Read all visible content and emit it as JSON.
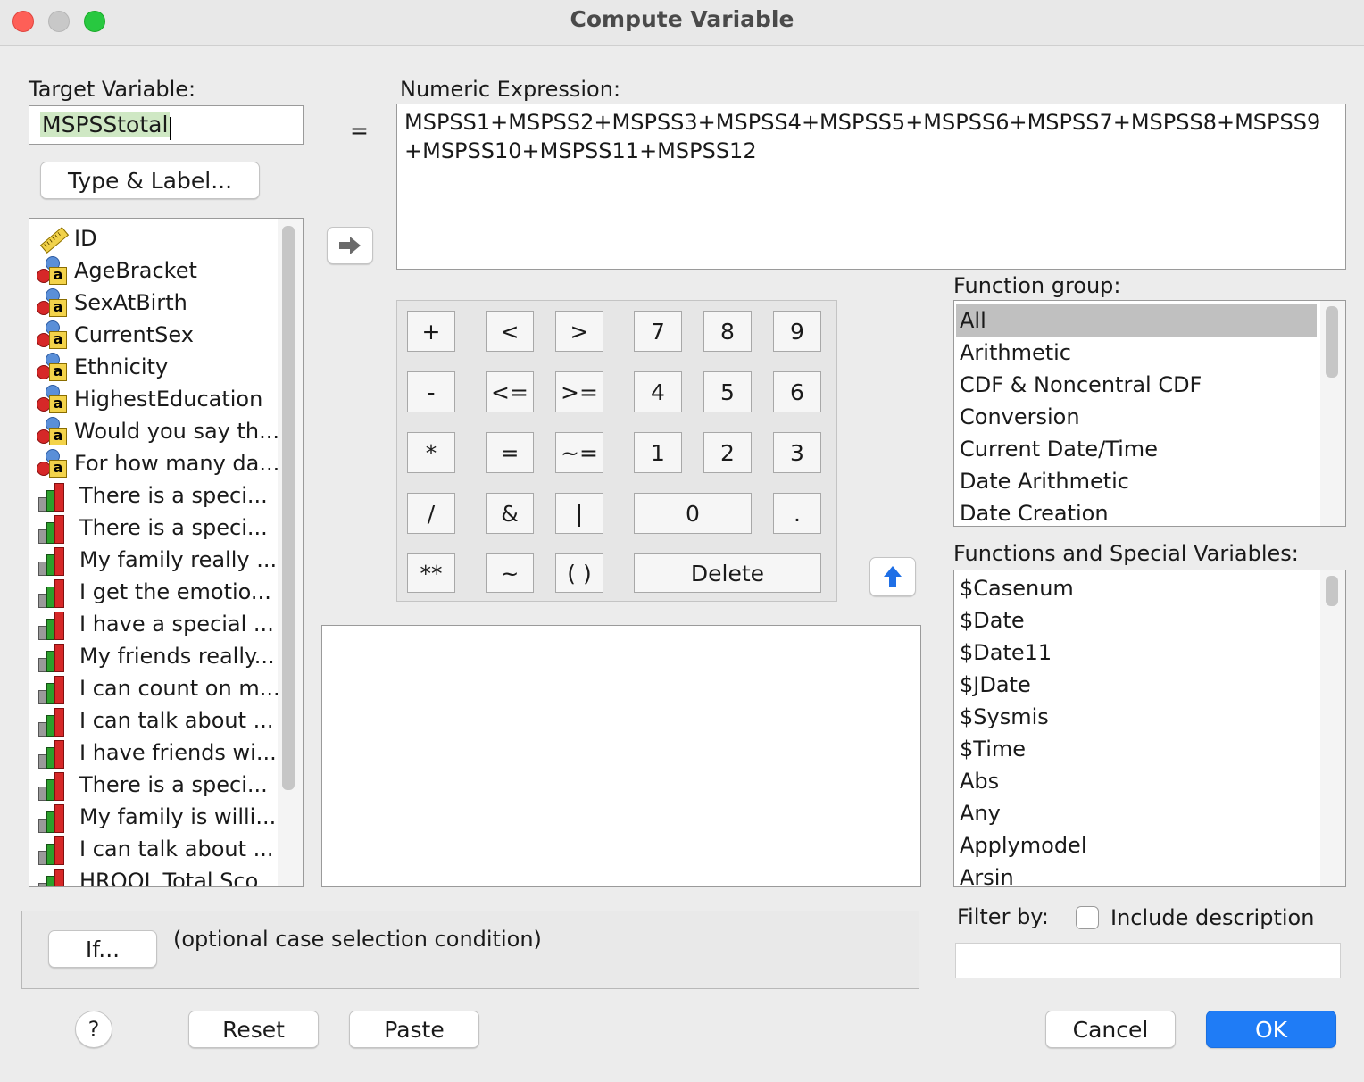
{
  "window": {
    "title": "Compute Variable"
  },
  "target": {
    "label": "Target Variable:",
    "value": "MSPSStotal",
    "type_label_button": "Type & Label..."
  },
  "equals": "=",
  "expression": {
    "label": "Numeric Expression:",
    "value": "MSPSS1+MSPSS2+MSPSS3+MSPSS4+MSPSS5+MSPSS6+MSPSS7+MSPSS8+MSPSS9+MSPSS10+MSPSS11+MSPSS12"
  },
  "variables": [
    {
      "label": "ID",
      "icon": "scale-ruler-icon"
    },
    {
      "label": "AgeBracket",
      "icon": "nominal-icon"
    },
    {
      "label": "SexAtBirth",
      "icon": "nominal-icon"
    },
    {
      "label": "CurrentSex",
      "icon": "nominal-icon"
    },
    {
      "label": "Ethnicity",
      "icon": "nominal-icon"
    },
    {
      "label": "HighestEducation",
      "icon": "nominal-icon"
    },
    {
      "label": "Would you say th...",
      "icon": "nominal-icon"
    },
    {
      "label": "For how many da...",
      "icon": "nominal-icon"
    },
    {
      "label": "There is a speci...",
      "icon": "ordinal-icon"
    },
    {
      "label": "There is a speci...",
      "icon": "ordinal-icon"
    },
    {
      "label": "My family really ...",
      "icon": "ordinal-icon"
    },
    {
      "label": "I get the emotio...",
      "icon": "ordinal-icon"
    },
    {
      "label": "I have a special ...",
      "icon": "ordinal-icon"
    },
    {
      "label": "My friends really...",
      "icon": "ordinal-icon"
    },
    {
      "label": "I can count on m...",
      "icon": "ordinal-icon"
    },
    {
      "label": "I can talk about ...",
      "icon": "ordinal-icon"
    },
    {
      "label": "I have friends wi...",
      "icon": "ordinal-icon"
    },
    {
      "label": "There is a speci...",
      "icon": "ordinal-icon"
    },
    {
      "label": "My family is willi...",
      "icon": "ordinal-icon"
    },
    {
      "label": "I can talk about ...",
      "icon": "ordinal-icon"
    },
    {
      "label": "HRQOL Total Sco...",
      "icon": "ordinal-icon"
    }
  ],
  "keypad": {
    "plus": "+",
    "lt": "<",
    "gt": ">",
    "k7": "7",
    "k8": "8",
    "k9": "9",
    "minus": "-",
    "le": "<=",
    "ge": ">=",
    "k4": "4",
    "k5": "5",
    "k6": "6",
    "mul": "*",
    "eq": "=",
    "ne": "~=",
    "k1": "1",
    "k2": "2",
    "k3": "3",
    "div": "/",
    "and": "&",
    "or": "|",
    "k0": "0",
    "dot": ".",
    "pow": "**",
    "not": "~",
    "paren": "( )",
    "delete": "Delete"
  },
  "function_group": {
    "label": "Function group:",
    "selected": "All",
    "items": [
      "All",
      "Arithmetic",
      "CDF & Noncentral CDF",
      "Conversion",
      "Current Date/Time",
      "Date Arithmetic",
      "Date Creation"
    ]
  },
  "functions": {
    "label": "Functions and Special Variables:",
    "items": [
      "$Casenum",
      "$Date",
      "$Date11",
      "$JDate",
      "$Sysmis",
      "$Time",
      "Abs",
      "Any",
      "Applymodel",
      "Arsin"
    ]
  },
  "condition": {
    "if_button": "If...",
    "text": "(optional case selection condition)"
  },
  "filter": {
    "label": "Filter by:",
    "include_description": "Include description",
    "checked": false,
    "value": ""
  },
  "buttons": {
    "help": "?",
    "reset": "Reset",
    "paste": "Paste",
    "cancel": "Cancel",
    "ok": "OK"
  },
  "colors": {
    "ok_button": "#1f7cf6",
    "selection": "#c0c0c0",
    "target_highlight": "#cfe8c4"
  }
}
